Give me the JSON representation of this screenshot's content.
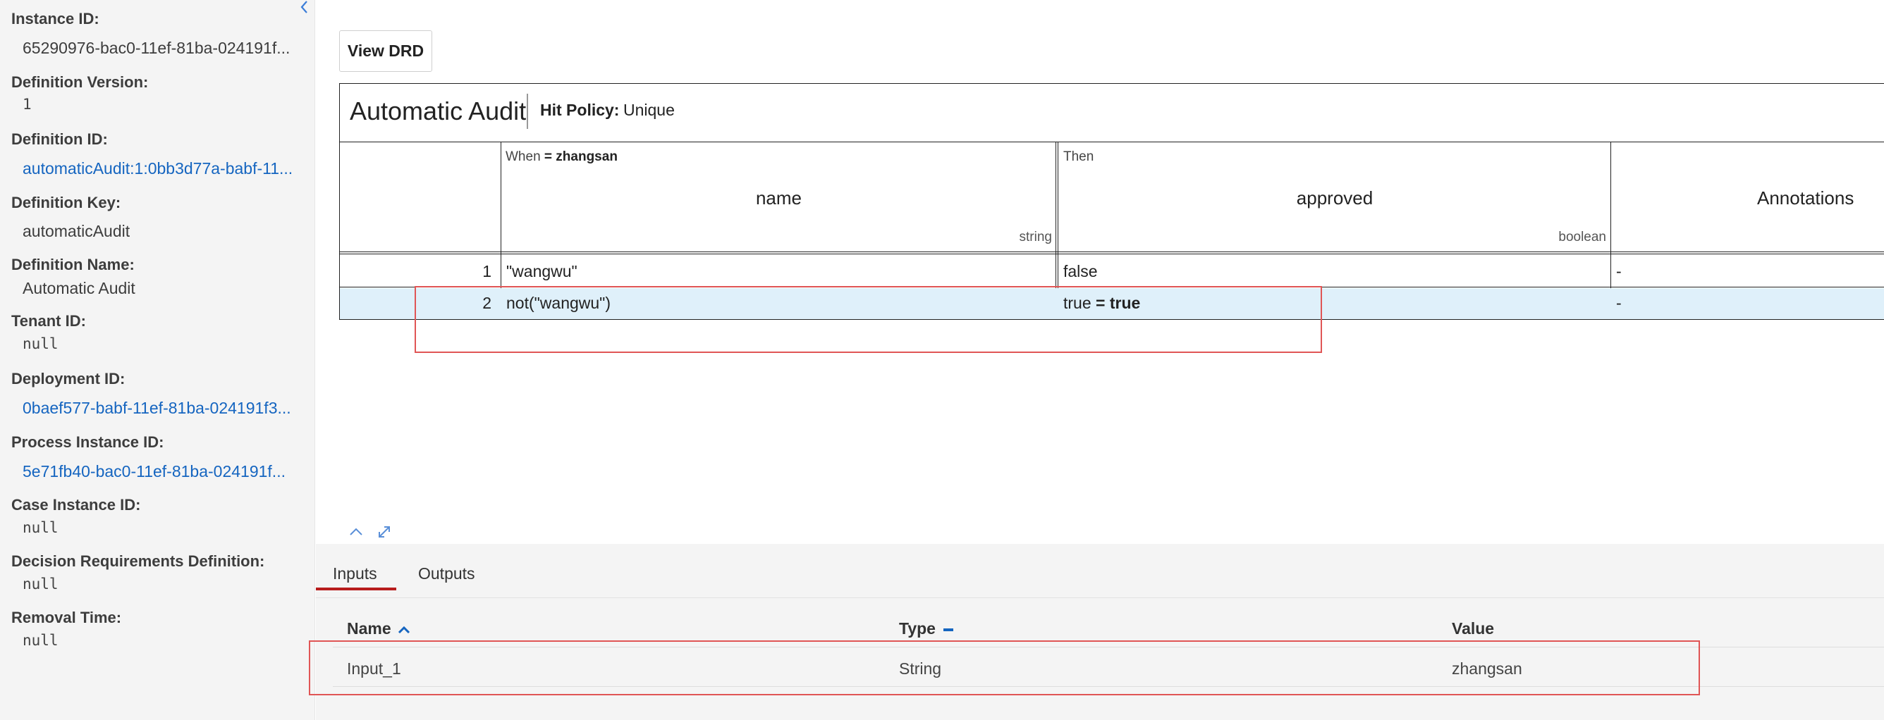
{
  "sidebar": {
    "properties": [
      {
        "label": "Instance ID:",
        "value": "65290976-bac0-11ef-81ba-024191f..."
      },
      {
        "label": "Definition Version:",
        "value": "1"
      },
      {
        "label": "Definition ID:",
        "value": "automaticAudit:1:0bb3d77a-babf-11..."
      },
      {
        "label": "Definition Key:",
        "value": "automaticAudit"
      },
      {
        "label": "Definition Name:",
        "value": "Automatic Audit"
      },
      {
        "label": "Tenant ID:",
        "value": "null"
      },
      {
        "label": "Deployment ID:",
        "value": "0baef577-babf-11ef-81ba-024191f3..."
      },
      {
        "label": "Process Instance ID:",
        "value": "5e71fb40-bac0-11ef-81ba-024191f..."
      },
      {
        "label": "Case Instance ID:",
        "value": "null"
      },
      {
        "label": "Decision Requirements Definition:",
        "value": "null"
      },
      {
        "label": "Removal Time:",
        "value": "null"
      }
    ]
  },
  "toolbar": {
    "view_drd_label": "View DRD"
  },
  "decision_table": {
    "title": "Automatic Audit",
    "hit_policy_label": "Hit Policy:",
    "hit_policy_value": "Unique",
    "input_header": {
      "prefix": "When",
      "eval": "= zhangsan",
      "name": "name",
      "type": "string"
    },
    "output_header": {
      "prefix": "Then",
      "name": "approved",
      "type": "boolean"
    },
    "annotations_header": "Annotations",
    "rules": [
      {
        "num": "1",
        "input": "\"wangwu\"",
        "output": "false",
        "output_eval": "",
        "annotation": "-"
      },
      {
        "num": "2",
        "input": "not(\"wangwu\")",
        "output": "true",
        "output_eval": "= true",
        "annotation": "-"
      }
    ],
    "selected_rule": 2
  },
  "bottom": {
    "tabs": [
      "Inputs",
      "Outputs"
    ],
    "active_tab": "Inputs",
    "columns": {
      "name": "Name",
      "type": "Type",
      "value": "Value"
    },
    "rows": [
      {
        "name": "Input_1",
        "type": "String",
        "value": "zhangsan"
      }
    ]
  },
  "colors": {
    "link": "#1565c0",
    "selected_row": "#dff0fa",
    "tab_active": "#b71c1c",
    "highlight": "#e05555"
  },
  "icons": {
    "collapse": "chevron-left-icon",
    "collapse_panel": "chevron-up-icon",
    "maximize": "expand-icon",
    "sort_asc": "caret-up-icon",
    "sort_none": "minus-icon"
  }
}
